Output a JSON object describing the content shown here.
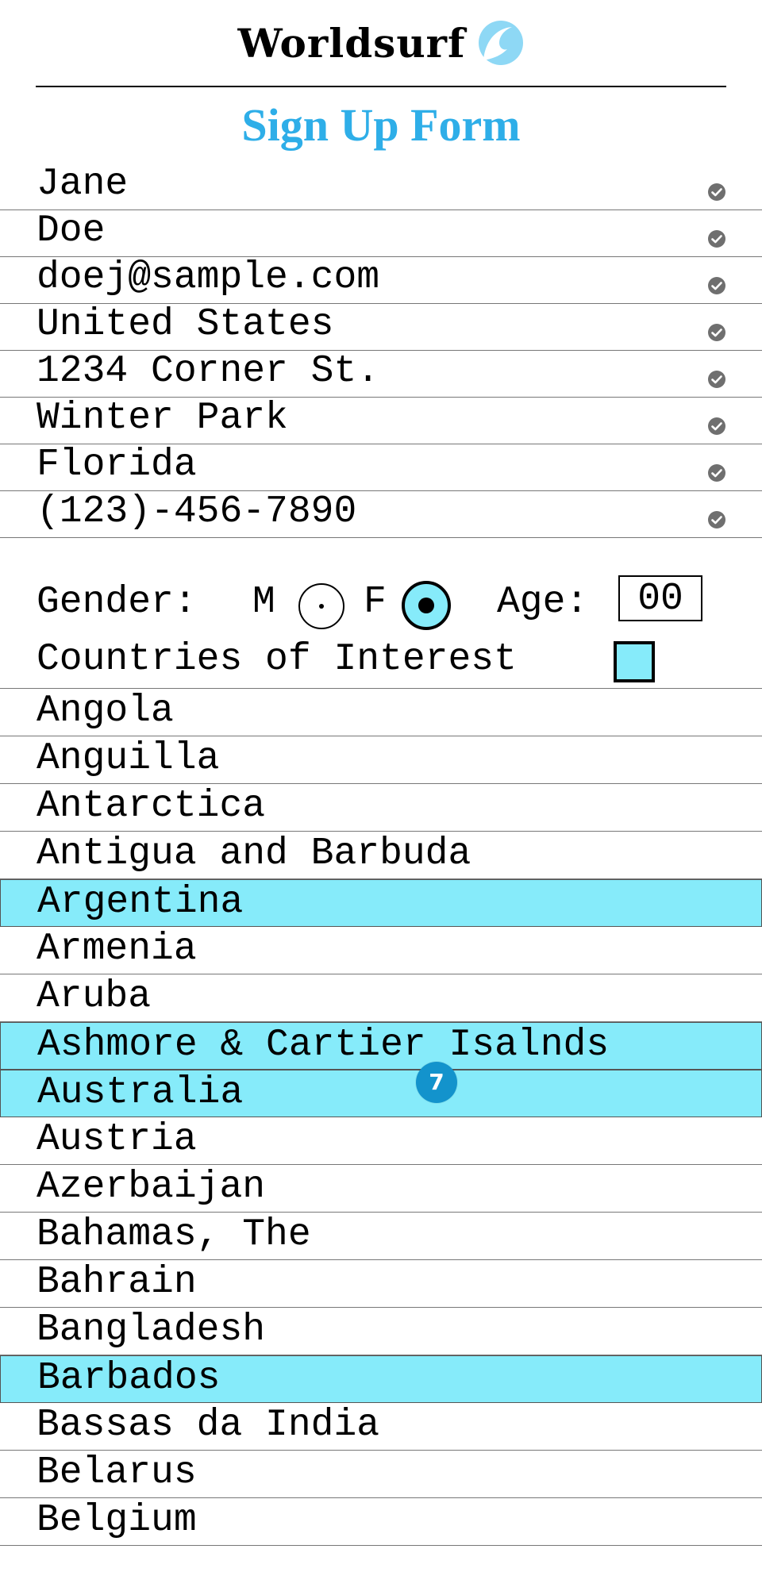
{
  "header": {
    "brand": "Worldsurf",
    "logo_icon": "wave-icon",
    "accent_color": "#2eaee8"
  },
  "form": {
    "title": "Sign Up Form",
    "fields": [
      {
        "name": "first-name",
        "value": "Jane"
      },
      {
        "name": "last-name",
        "value": "Doe"
      },
      {
        "name": "email",
        "value": "doej@sample.com"
      },
      {
        "name": "country",
        "value": "United States"
      },
      {
        "name": "address",
        "value": "1234 Corner St."
      },
      {
        "name": "city",
        "value": "Winter Park"
      },
      {
        "name": "state",
        "value": "Florida"
      },
      {
        "name": "phone",
        "value": "(123)-456-7890"
      }
    ],
    "valid_icon": "check-circle-icon",
    "gender": {
      "label": "Gender:",
      "option_m": "M",
      "option_f": "F",
      "selected": "F"
    },
    "age": {
      "label": "Age:",
      "value": "00"
    },
    "countries": {
      "label": "Countries of Interest",
      "items": [
        {
          "name": "Angola",
          "selected": false
        },
        {
          "name": "Anguilla",
          "selected": false
        },
        {
          "name": "Antarctica",
          "selected": false
        },
        {
          "name": "Antigua and Barbuda",
          "selected": false
        },
        {
          "name": "Argentina",
          "selected": true
        },
        {
          "name": "Armenia",
          "selected": false
        },
        {
          "name": "Aruba",
          "selected": false
        },
        {
          "name": "Ashmore & Cartier Isalnds",
          "selected": true
        },
        {
          "name": "Australia",
          "selected": true
        },
        {
          "name": "Austria",
          "selected": false
        },
        {
          "name": "Azerbaijan",
          "selected": false
        },
        {
          "name": "Bahamas, The",
          "selected": false
        },
        {
          "name": "Bahrain",
          "selected": false
        },
        {
          "name": "Bangladesh",
          "selected": false
        },
        {
          "name": "Barbados",
          "selected": true
        },
        {
          "name": "Bassas da India",
          "selected": false
        },
        {
          "name": "Belarus",
          "selected": false
        },
        {
          "name": "Belgium",
          "selected": false
        }
      ]
    },
    "selection_badge": "7",
    "highlight_color": "#86ebfa"
  }
}
